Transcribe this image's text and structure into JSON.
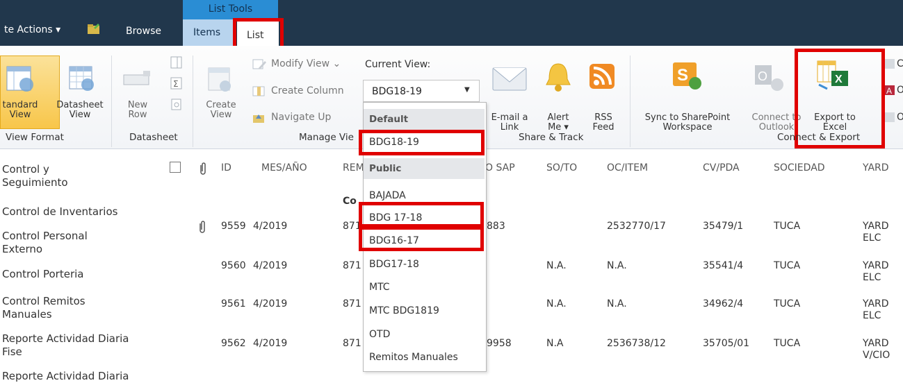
{
  "topbar": {
    "site_actions": "te Actions ▾",
    "browse": "Browse",
    "list_tools": "List Tools",
    "items_tab": "Items",
    "list_tab": "List"
  },
  "ribbon": {
    "standard_view": [
      "tandard",
      "View"
    ],
    "datasheet_view": [
      "Datasheet",
      "View"
    ],
    "new_row": [
      "New",
      "Row"
    ],
    "create_view": [
      "Create",
      "View"
    ],
    "modify_view": "Modify View ⌄",
    "create_column": "Create Column",
    "navigate_up": "Navigate Up",
    "current_view_label": "Current View:",
    "current_view_value": "BDG18-19",
    "email_link": [
      "E-mail a",
      "Link"
    ],
    "alert_me": [
      "Alert",
      "Me ▾"
    ],
    "rss_feed": [
      "RSS",
      "Feed"
    ],
    "sync_sharepoint": [
      "Sync to SharePoint",
      "Workspace"
    ],
    "connect_outlook": [
      "Connect to",
      "Outlook"
    ],
    "export_excel": [
      "Export to",
      "Excel"
    ],
    "right_small": [
      "C",
      "O",
      "O"
    ],
    "groups": {
      "view_format": "View Format",
      "datasheet": "Datasheet",
      "manage_views": "Manage Vie",
      "share_track": "Share & Track",
      "connect_export": "Connect & Export"
    }
  },
  "dropdown": {
    "default_header": "Default",
    "default_items": [
      "BDG18-19"
    ],
    "public_header": "Public",
    "public_items": [
      "BAJADA",
      "BDG 17-18",
      "BDG16-17",
      "BDG17-18",
      "MTC",
      "MTC BDG1819",
      "OTD",
      "Remitos Manuales"
    ]
  },
  "nav": {
    "items": [
      "Control y\nSeguimiento",
      "Control de Inventarios",
      "Control Personal\nExterno",
      "Control Porteria",
      "Control Remitos\nManuales",
      "Reporte Actividad Diaria\nFise",
      "Reporte Actividad Diaria"
    ]
  },
  "table": {
    "headers": [
      "ID",
      "MES/AÑO",
      "REM",
      "O SAP",
      "SO/TO",
      "OC/ITEM",
      "CV/PDA",
      "SOCIEDAD",
      "YARD"
    ],
    "group_label": "Co",
    "rows": [
      {
        "id": "9559",
        "mes": "4/2019",
        "rem": "871",
        "sap": "883",
        "soto": "",
        "oc": "2532770/17",
        "cv": "35479/1",
        "soc": "TUCA",
        "yard": "YARD\nELC"
      },
      {
        "id": "9560",
        "mes": "4/2019",
        "rem": "871",
        "sap": "",
        "soto": "N.A.",
        "oc": "N.A.",
        "cv": "35541/4",
        "soc": "TUCA",
        "yard": "YARD\nELC"
      },
      {
        "id": "9561",
        "mes": "4/2019",
        "rem": "871",
        "sap": "",
        "soto": "N.A.",
        "oc": "N.A.",
        "cv": "34962/4",
        "soc": "TUCA",
        "yard": "YARD\nELC"
      },
      {
        "id": "9562",
        "mes": "4/2019",
        "rem": "871",
        "sap": "9958",
        "soto": "N.A",
        "oc": "2536738/12",
        "cv": "35705/01",
        "soc": "TUCA",
        "yard": "YARD\nV/CIO"
      }
    ]
  },
  "colors": {
    "topbar": "#21374c",
    "list_tools": "#2a8dd4",
    "highlight_red": "#e00000",
    "selected_button": "#f8c64a"
  }
}
